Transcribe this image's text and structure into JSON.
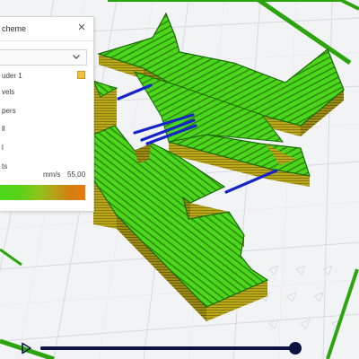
{
  "colors": {
    "extruder": "#f0c038",
    "infill_green": "#4cd81a",
    "wall_olive": "#b8a818",
    "travel_blue": "#1424c8",
    "timeline": "#0d1240"
  },
  "color_scheme_panel": {
    "title": "cheme",
    "close_icon": "close-icon",
    "dropdown_icon": "chevron-down-icon",
    "legend": [
      {
        "label": "uder 1"
      },
      {
        "label": "vels"
      },
      {
        "label": "pers"
      },
      {
        "label": "ll"
      },
      {
        "label": "l"
      },
      {
        "label": "ts"
      }
    ],
    "speed": {
      "unit": "mm/s",
      "max": "55,00"
    }
  },
  "timeline": {
    "play_icon": "play-icon",
    "progress": 0.98
  }
}
